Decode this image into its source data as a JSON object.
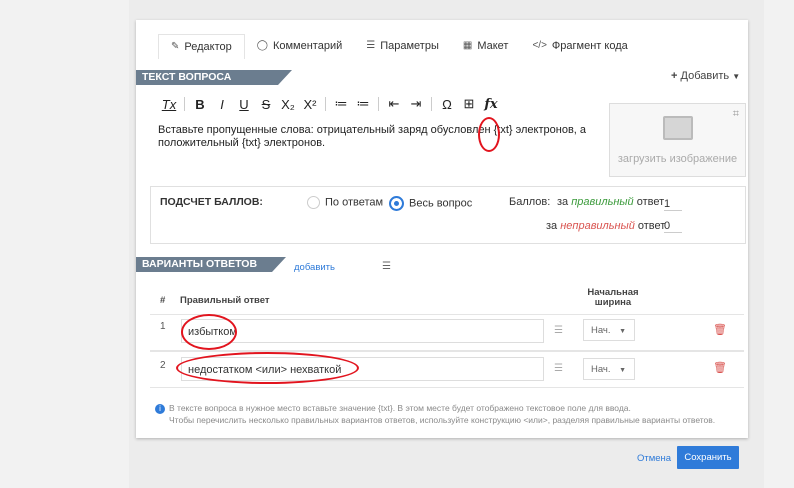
{
  "tabs": [
    {
      "icon": "✎",
      "label": "Редактор"
    },
    {
      "icon": "◯",
      "label": "Комментарий"
    },
    {
      "icon": "☰",
      "label": "Параметры"
    },
    {
      "icon": "▦",
      "label": "Макет"
    },
    {
      "icon": "</>",
      "label": "Фрагмент кода"
    }
  ],
  "question": {
    "section_title": "ТЕКСТ ВОПРОСА",
    "add_button": "Добавить",
    "text": "Вставьте пропущенные слова: отрицательный заряд обусловлен {txt} электронов, а положительный {txt} электронов.",
    "image_upload_label": "загрузить изображение"
  },
  "toolbar": [
    "Tx",
    "B",
    "I",
    "U",
    "S",
    "X₂",
    "X²",
    "≔",
    "≔",
    "⇤",
    "⇥",
    "Ω",
    "⊞",
    "fx"
  ],
  "scoring": {
    "title": "ПОДСЧЕТ БАЛЛОВ:",
    "option_by_answers": "По ответам",
    "option_whole_question": "Весь вопрос",
    "points_label": "Баллов:",
    "for_correct": "за",
    "correct_word": "правильный",
    "answer_word": "ответ",
    "incorrect_word": "неправильный",
    "correct_points": "1",
    "incorrect_points": "0"
  },
  "answers": {
    "section_title": "ВАРИАНТЫ ОТВЕТОВ",
    "add_link": "добавить",
    "col_num": "#",
    "col_correct": "Правильный ответ",
    "col_width": "Начальная ширина",
    "rows": [
      {
        "num": "1",
        "value": "избытком",
        "width": "Нач."
      },
      {
        "num": "2",
        "value": "недостатком <или> нехваткой",
        "width": "Нач."
      }
    ]
  },
  "info": {
    "line1": "В тексте вопроса в нужное место вставьте значение {txt}. В этом месте будет отображено текстовое поле для ввода.",
    "line2": "Чтобы перечислить несколько правильных вариантов ответов, используйте конструкцию <или>, разделяя правильные варианты ответов."
  },
  "footer": {
    "cancel": "Отмена",
    "save": "Сохранить"
  },
  "colors": {
    "accent": "#2f7bd9",
    "section": "#6b7d8f",
    "annotation": "#e2141e"
  }
}
